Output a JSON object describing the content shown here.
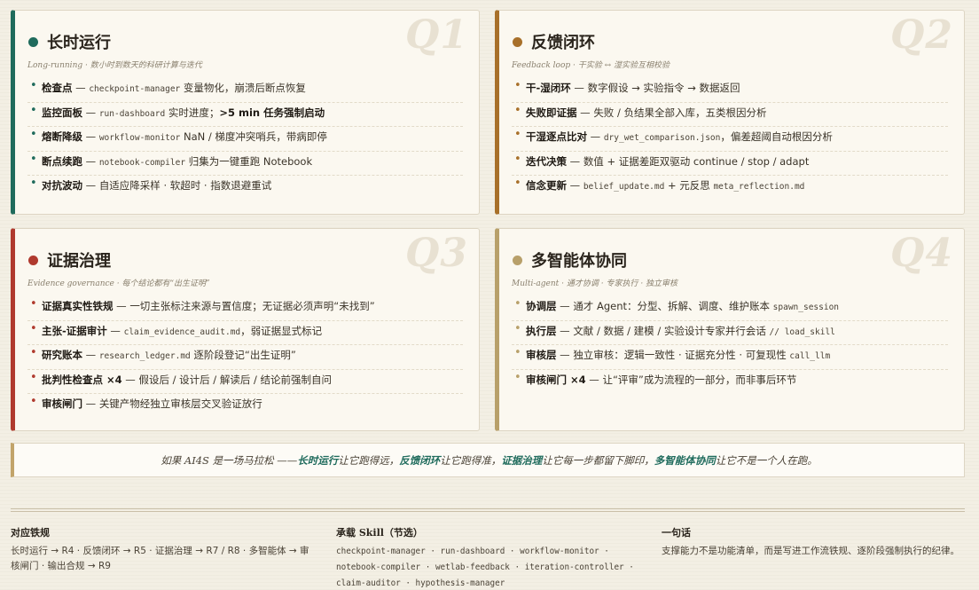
{
  "colors": {
    "q1": "#1f6b5c",
    "q2": "#a8702a",
    "q3": "#b03a2e",
    "q4": "#b8a06a"
  },
  "q1": {
    "mark": "Q1",
    "title": "长时运行",
    "subtitle": "Long-running · 数小时到数天的科研计算与迭代",
    "items": [
      {
        "k": "检查点",
        "pre": " — ",
        "code": "checkpoint-manager",
        "rest": " 变量物化，崩溃后断点恢复"
      },
      {
        "k": "监控面板",
        "pre": " — ",
        "code": "run-dashboard",
        "rest": " 实时进度；",
        "k2": ">5 min 任务强制启动"
      },
      {
        "k": "熔断降级",
        "pre": " — ",
        "code": "workflow-monitor",
        "rest": " NaN / 梯度冲突哨兵，带病即停"
      },
      {
        "k": "断点续跑",
        "pre": " — ",
        "code": "notebook-compiler",
        "rest": " 归集为一键重跑 Notebook"
      },
      {
        "k": "对抗波动",
        "pre": " — ",
        "code": "",
        "rest": "自适应降采样 · 软超时 · 指数退避重试"
      }
    ]
  },
  "q2": {
    "mark": "Q2",
    "title": "反馈闭环",
    "subtitle": "Feedback loop · 干实验 ↔ 湿实验互相校验",
    "items": [
      {
        "k": "干-湿闭环",
        "pre": " — ",
        "code": "",
        "rest": "数字假设 → 实验指令 → 数据返回"
      },
      {
        "k": "失败即证据",
        "pre": " — ",
        "code": "",
        "rest": "失败 / 负结果全部入库，五类根因分析"
      },
      {
        "k": "干湿逐点比对",
        "pre": " — ",
        "code": "dry_wet_comparison.json",
        "rest": "，偏差超阈自动根因分析"
      },
      {
        "k": "迭代决策",
        "pre": " — ",
        "code": "",
        "rest": "数值 + 证据差距双驱动 continue / stop / adapt"
      },
      {
        "k": "信念更新",
        "pre": " — ",
        "code": "belief_update.md",
        "rest": " + 元反思 ",
        "code2": "meta_reflection.md"
      }
    ]
  },
  "q3": {
    "mark": "Q3",
    "title": "证据治理",
    "subtitle": "Evidence governance · 每个结论都有“出生证明”",
    "items": [
      {
        "k": "证据真实性铁规",
        "pre": " — ",
        "code": "",
        "rest": "一切主张标注来源与置信度；无证据必须声明“未找到”"
      },
      {
        "k": "主张-证据审计",
        "pre": " — ",
        "code": "claim_evidence_audit.md",
        "rest": "，弱证据显式标记"
      },
      {
        "k": "研究账本",
        "pre": " — ",
        "code": "research_ledger.md",
        "rest": " 逐阶段登记“出生证明”"
      },
      {
        "k": "批判性检查点 ×4",
        "pre": " — ",
        "code": "",
        "rest": "假设后 / 设计后 / 解读后 / 结论前强制自问"
      },
      {
        "k": "审核闸门",
        "pre": " — ",
        "code": "",
        "rest": "关键产物经独立审核层交叉验证放行"
      }
    ]
  },
  "q4": {
    "mark": "Q4",
    "title": "多智能体协同",
    "subtitle": "Multi-agent · 通才协调 · 专家执行 · 独立审核",
    "items": [
      {
        "k": "协调层",
        "pre": " — ",
        "code": "",
        "rest": "通才 Agent：分型、拆解、调度、维护账本 ",
        "code2": "spawn_session"
      },
      {
        "k": "执行层",
        "pre": " — ",
        "code": "",
        "rest": "文献 / 数据 / 建模 / 实验设计专家并行会话 ",
        "code2": "// load_skill"
      },
      {
        "k": "审核层",
        "pre": " — ",
        "code": "",
        "rest": "独立审核：逻辑一致性 · 证据充分性 · 可复现性 ",
        "code2": "call_llm"
      },
      {
        "k": "审核闸门 ×4",
        "pre": " — ",
        "code": "",
        "rest": "让“评审”成为流程的一部分，而非事后环节"
      }
    ]
  },
  "banner": {
    "p1": "如果 AI4S 是一场马拉松 —— ",
    "h1": "长时运行",
    "p2": "让它跑得远，",
    "h2": "反馈闭环",
    "p3": "让它跑得准，",
    "h3": "证据治理",
    "p4": "让它每一步都留下脚印，",
    "h4": "多智能体协同",
    "p5": "让它不是一个人在跑。"
  },
  "footer": {
    "col1": {
      "heading": "对应铁规",
      "body": "长时运行 → R4 · 反馈闭环 → R5 · 证据治理 → R7 / R8 · 多智能体 → 审核闸门 · 输出合规 → R9"
    },
    "col2": {
      "heading": "承载 Skill（节选）",
      "body": "checkpoint-manager · run-dashboard · workflow-monitor · notebook-compiler · wetlab-feedback · iteration-controller · claim-auditor · hypothesis-manager"
    },
    "col3": {
      "heading": "一句话",
      "body": "支撑能力不是功能清单，而是写进工作流铁规、逐阶段强制执行的纪律。"
    }
  }
}
